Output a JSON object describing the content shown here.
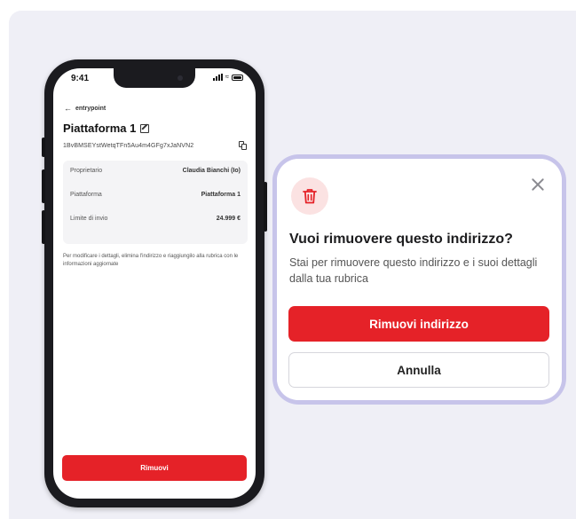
{
  "phone": {
    "status_time": "9:41",
    "back_label": "entrypoint",
    "title": "Piattaforma 1",
    "address": "1BvBMSEYstWetqTFn5Au4m4GFg7xJaNVN2",
    "details": [
      {
        "label": "Proprietario",
        "value": "Claudia Bianchi (Io)"
      },
      {
        "label": "Piattaforma",
        "value": "Piattaforma 1"
      },
      {
        "label": "Limite di invio",
        "value": "24.999 €"
      }
    ],
    "note": "Per modificare i dettagli, elimina l'indirizzo e riaggiungilo alla rubrica con le informazioni aggiornate",
    "remove_button": "Rimuovi"
  },
  "dialog": {
    "title": "Vuoi rimuovere questo indirizzo?",
    "body": "Stai per rimuovere questo indirizzo e i suoi dettagli dalla tua rubrica",
    "confirm_button": "Rimuovi indirizzo",
    "cancel_button": "Annulla"
  },
  "colors": {
    "accent_red": "#e52228",
    "badge_bg": "#fbe2e2",
    "dialog_border": "#c7c4ea",
    "stage_bg": "#efeff6"
  },
  "icons": [
    "back-arrow-icon",
    "edit-icon",
    "copy-icon",
    "trash-icon",
    "close-icon",
    "signal-icon",
    "wifi-icon",
    "battery-icon"
  ]
}
